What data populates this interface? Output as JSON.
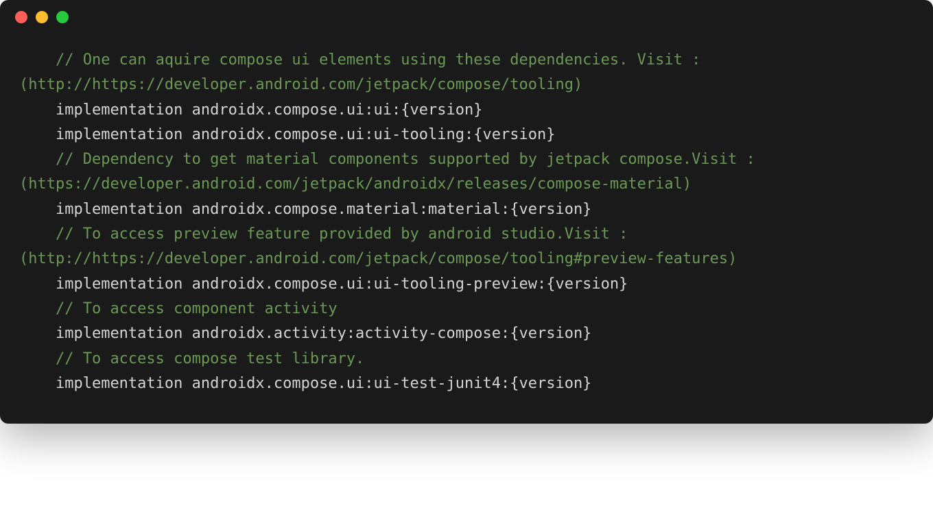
{
  "window": {
    "traffic_lights": [
      "close",
      "minimize",
      "maximize"
    ]
  },
  "code": {
    "lines": [
      {
        "indent": true,
        "spans": [
          {
            "cls": "comment",
            "text": "// One can aquire compose ui elements using these dependencies. Visit : (http://https://developer.android.com/jetpack/compose/tooling)"
          }
        ]
      },
      {
        "indent": true,
        "spans": [
          {
            "cls": "plain",
            "text": "implementation androidx.compose.ui:ui:{version}"
          }
        ]
      },
      {
        "indent": true,
        "spans": [
          {
            "cls": "plain",
            "text": "implementation androidx.compose.ui:ui-tooling:{version}"
          }
        ]
      },
      {
        "indent": true,
        "spans": [
          {
            "cls": "comment",
            "text": "// Dependency to get material components supported by jetpack compose.Visit : (https://developer.android.com/jetpack/androidx/releases/compose-material)"
          }
        ]
      },
      {
        "indent": true,
        "spans": [
          {
            "cls": "plain",
            "text": "implementation androidx.compose.material:material:{version}"
          }
        ]
      },
      {
        "indent": true,
        "spans": [
          {
            "cls": "comment",
            "text": "// To access preview feature provided by android studio.Visit :(http://https://developer.android.com/jetpack/compose/tooling#preview-features)"
          }
        ]
      },
      {
        "indent": true,
        "spans": [
          {
            "cls": "plain",
            "text": "implementation androidx.compose.ui:ui-tooling-preview:{version}"
          }
        ]
      },
      {
        "indent": true,
        "spans": [
          {
            "cls": "comment",
            "text": "// To access component activity"
          }
        ]
      },
      {
        "indent": true,
        "spans": [
          {
            "cls": "plain",
            "text": "implementation androidx.activity:activity-compose:{version}"
          }
        ]
      },
      {
        "indent": true,
        "spans": [
          {
            "cls": "comment",
            "text": "// To access compose test library."
          }
        ]
      },
      {
        "indent": true,
        "spans": [
          {
            "cls": "plain",
            "text": "implementation androidx.compose.ui:ui-test-junit4:{version}"
          }
        ]
      }
    ]
  }
}
